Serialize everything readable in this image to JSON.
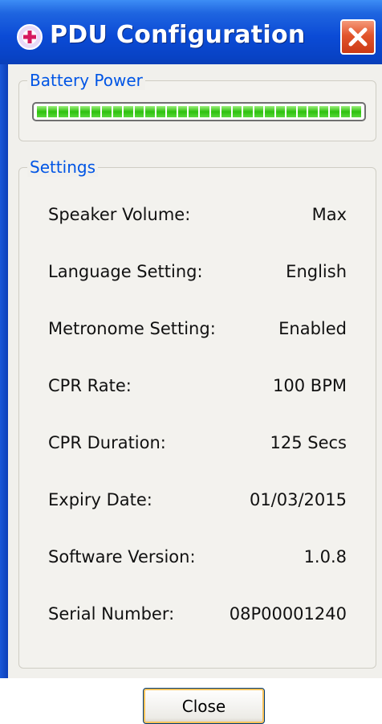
{
  "window": {
    "title": "PDU Configuration"
  },
  "battery": {
    "legend": "Battery Power",
    "level": 1.0,
    "segment_color": "#2ec10f"
  },
  "settings": {
    "legend": "Settings",
    "rows": [
      {
        "label": "Speaker Volume:",
        "value": "Max"
      },
      {
        "label": "Language Setting:",
        "value": "English"
      },
      {
        "label": "Metronome Setting:",
        "value": "Enabled"
      },
      {
        "label": "CPR Rate:",
        "value": "100 BPM"
      },
      {
        "label": "CPR Duration:",
        "value": "125 Secs"
      },
      {
        "label": "Expiry Date:",
        "value": "01/03/2015"
      },
      {
        "label": "Software Version:",
        "value": "1.0.8"
      },
      {
        "label": "Serial Number:",
        "value": "08P00001240"
      }
    ]
  },
  "footer": {
    "close_label": "Close"
  },
  "colors": {
    "titlebar": "#0b4bd6",
    "legend_text": "#0055e5",
    "close_x": "#e2552c"
  }
}
